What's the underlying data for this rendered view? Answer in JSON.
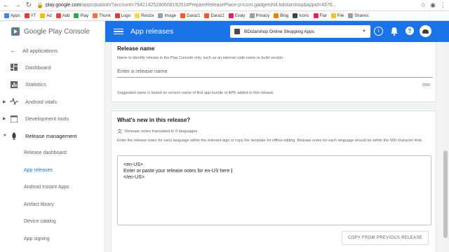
{
  "browser": {
    "url_host": "play.google.com",
    "url_rest": "/apps/publish/?account=7942142528060819251#PrepareReleasePlace:p=com.gadgetshill.bdstarshop&appid=4976...",
    "bookmarks": [
      "Apps",
      "YT",
      "Ad",
      "Add",
      "Play",
      "Thunk",
      "Logo",
      "Resize",
      "Image",
      "Daraz1",
      "Daraz2",
      "Evaly",
      "Privacy",
      "Blog",
      "Icons",
      "Flat",
      "File",
      "Shanes"
    ],
    "colors": {
      "bookmark_icons": [
        "#4285f4",
        "#e53935",
        "#fbbc04",
        "#f44336",
        "#34a853",
        "#ff7043",
        "#e53935",
        "#fdd835",
        "#90a4ae",
        "#ff5722",
        "#ff5722",
        "#e91e63",
        "#9e9e9e",
        "#f57c00",
        "#424242",
        "#e91e63",
        "#fbc02d",
        "#9e9e9e"
      ]
    }
  },
  "sidebar": {
    "logo_text": "Google Play Console",
    "back_label": "All applications",
    "items": [
      {
        "label": "Dashboard",
        "icon": "dashboard-icon"
      },
      {
        "label": "Statistics",
        "icon": "statistics-icon"
      },
      {
        "label": "Android vitals",
        "icon": "vitals-icon"
      },
      {
        "label": "Development tools",
        "icon": "dev-tools-icon"
      },
      {
        "label": "Release management",
        "icon": "rocket-icon"
      }
    ],
    "sub_items": [
      "Release dashboard",
      "App releases",
      "Android Instant Apps",
      "Artifact library",
      "Device catalog",
      "App signing"
    ]
  },
  "appbar": {
    "title": "App releases",
    "app_name": "BDstarshop Online Shopping Apps",
    "accent": "#1a73e8"
  },
  "release_name": {
    "title": "Release name",
    "desc": "Name to identify release in the Play Console only, such as an internal code name or build version.",
    "placeholder": "Enter a release name",
    "counter": "0/50",
    "hint": "Suggested name is based on version name of first app bundle or APK added to this release."
  },
  "whats_new": {
    "title": "What's new in this release?",
    "translated": "Release notes translated in 0 languages",
    "desc": "Enter the release notes for each language within the relevant tags or copy the template for offline editing. Release notes for each language should be within the 500 character limit.",
    "lines": [
      "<en-US>",
      "Enter or paste your release notes for en-US here",
      "</en-US>"
    ],
    "copy_button": "COPY FROM PREVIOUS RELEASE"
  }
}
